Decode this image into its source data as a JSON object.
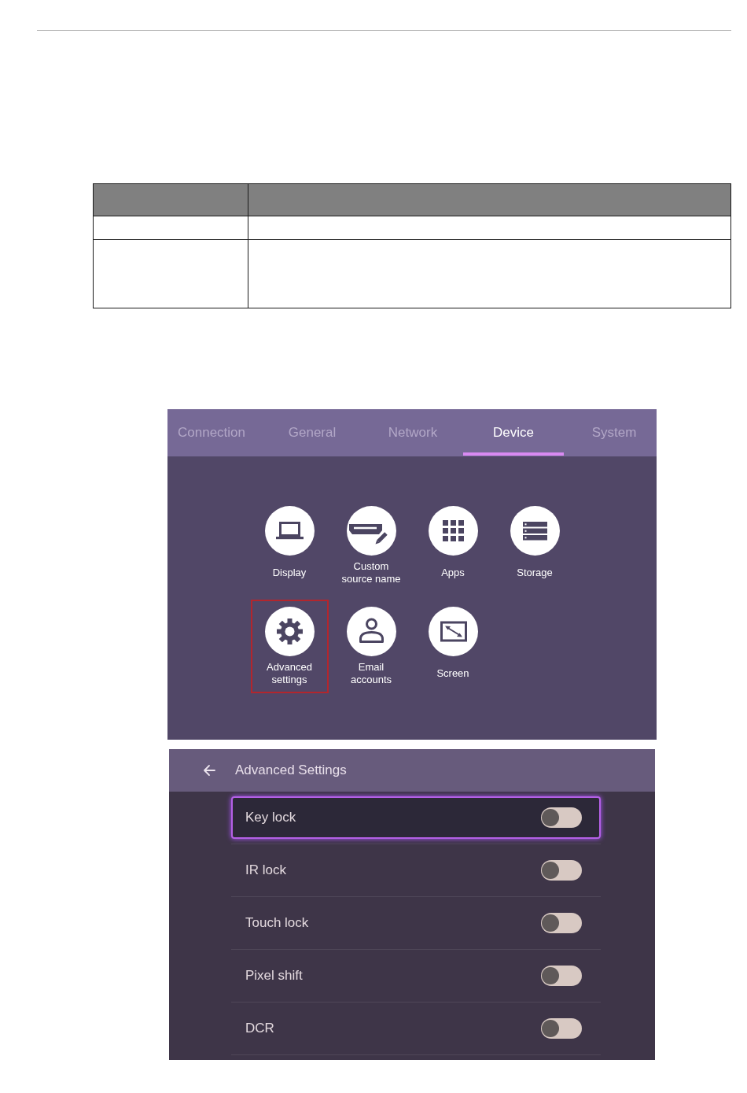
{
  "table": {
    "rows": [
      {
        "kind": "header"
      },
      {
        "kind": "short"
      },
      {
        "kind": "tall"
      }
    ]
  },
  "device_settings": {
    "tabs": [
      {
        "label": "Connection",
        "selected": false
      },
      {
        "label": "General",
        "selected": false
      },
      {
        "label": "Network",
        "selected": false
      },
      {
        "label": "Device",
        "selected": true
      },
      {
        "label": "System",
        "selected": false
      }
    ],
    "categories": [
      {
        "label": "Display",
        "highlighted": false
      },
      {
        "label": "Custom source name",
        "highlighted": false
      },
      {
        "label": "Apps",
        "highlighted": false
      },
      {
        "label": "Storage",
        "highlighted": false
      },
      {
        "label": "Advanced settings",
        "highlighted": true
      },
      {
        "label": "Email accounts",
        "highlighted": false
      },
      {
        "label": "Screen",
        "highlighted": false
      }
    ]
  },
  "advanced_settings": {
    "title": "Advanced Settings",
    "settings": [
      {
        "label": "Key lock",
        "selected": true,
        "on": false
      },
      {
        "label": "IR lock",
        "selected": false,
        "on": false
      },
      {
        "label": "Touch lock",
        "selected": false,
        "on": false
      },
      {
        "label": "Pixel shift",
        "selected": false,
        "on": false
      },
      {
        "label": "DCR",
        "selected": false,
        "on": false
      }
    ]
  }
}
